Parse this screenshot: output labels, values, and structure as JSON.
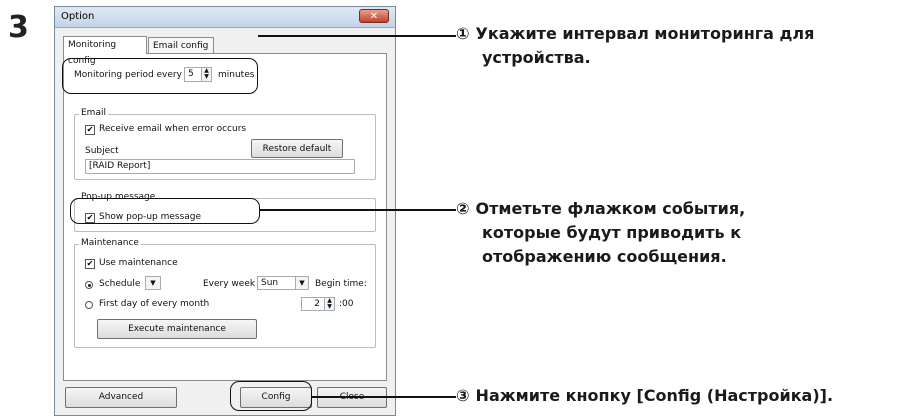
{
  "step_number": "3",
  "dialog": {
    "title": "Option",
    "close_symbol": "✕",
    "tabs": [
      "Monitoring config",
      "Email config"
    ],
    "monitoring": {
      "label_before": "Monitoring period every",
      "value": "5",
      "label_after": "minutes"
    },
    "email": {
      "group_title": "Email",
      "receive_checkbox": {
        "label": "Receive email when error occurs",
        "checked": true
      },
      "subject_label": "Subject",
      "restore_button": "Restore default",
      "subject_value": "[RAID Report]"
    },
    "popup": {
      "group_title": "Pop-up message",
      "show_checkbox": {
        "label": "Show pop-up message",
        "checked": true
      }
    },
    "maintenance": {
      "group_title": "Maintenance",
      "use_checkbox": {
        "label": "Use maintenance",
        "checked": true
      },
      "schedule_label": "Schedule",
      "every_week_label": "Every week",
      "day_value": "Sun",
      "begin_time_label": "Begin time:",
      "first_day_label": "First day of every month",
      "hour_value": "2",
      "minute_suffix": ":00",
      "execute_button": "Execute maintenance"
    },
    "buttons": {
      "advanced": "Advanced",
      "config": "Config",
      "close": "Close"
    }
  },
  "annotations": [
    {
      "num": "①",
      "lines": [
        "Укажите интервал мониторинга для",
        "устройства."
      ]
    },
    {
      "num": "②",
      "lines": [
        "Отметьте флажком события,",
        "которые будут приводить к",
        "отображению сообщения."
      ]
    },
    {
      "num": "③",
      "lines": [
        "Нажмите кнопку [Config (Настройка)]."
      ]
    }
  ],
  "checkmark": "✔",
  "spin_up": "▲",
  "spin_down": "▼",
  "dropdown_arrow": "▼"
}
